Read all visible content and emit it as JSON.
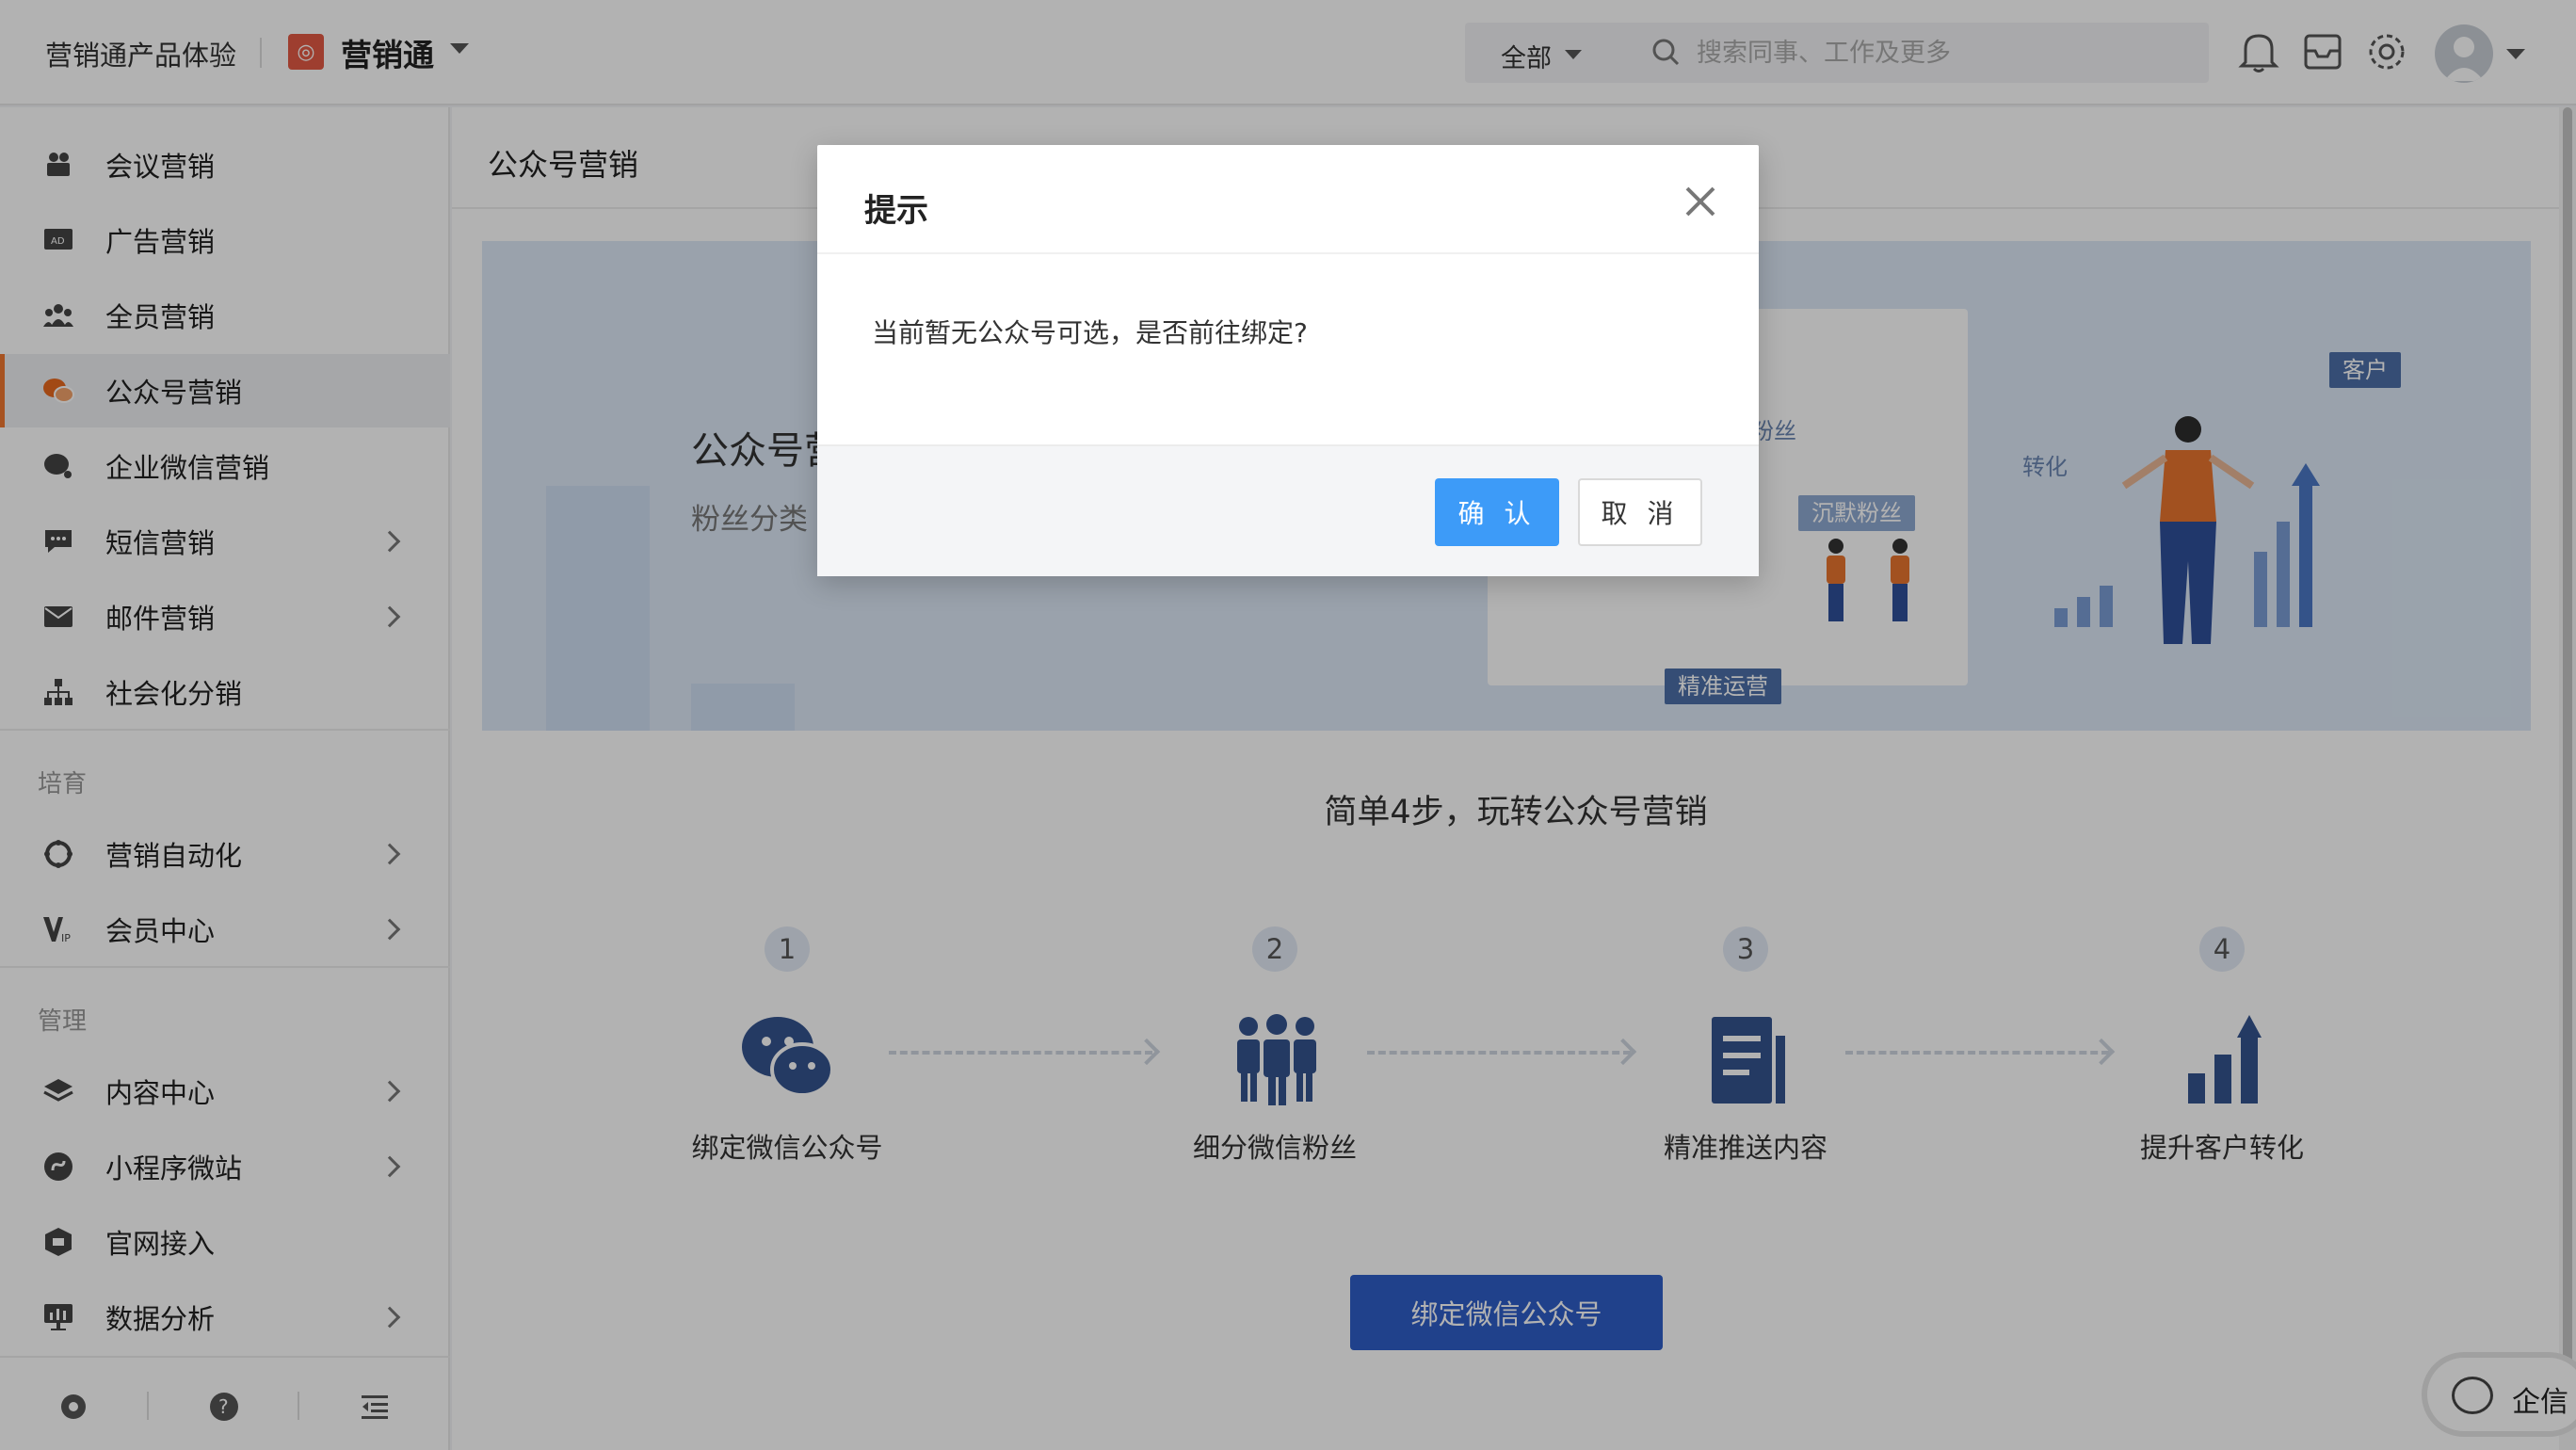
{
  "header": {
    "org_name": "营销通产品体验",
    "app_name": "营销通",
    "search_scope": "全部",
    "search_placeholder": "搜索同事、工作及更多"
  },
  "sidebar": {
    "items": [
      {
        "label": "会议营销",
        "icon": "meeting-icon",
        "chevron": false
      },
      {
        "label": "广告营销",
        "icon": "ad-icon",
        "chevron": false
      },
      {
        "label": "全员营销",
        "icon": "team-icon",
        "chevron": false
      },
      {
        "label": "公众号营销",
        "icon": "wechat-icon",
        "chevron": false,
        "active": true
      },
      {
        "label": "企业微信营销",
        "icon": "work-wechat-icon",
        "chevron": false
      },
      {
        "label": "短信营销",
        "icon": "sms-icon",
        "chevron": true
      },
      {
        "label": "邮件营销",
        "icon": "mail-icon",
        "chevron": true
      },
      {
        "label": "社会化分销",
        "icon": "org-tree-icon",
        "chevron": false
      }
    ],
    "section_nurture": "培育",
    "nurture_items": [
      {
        "label": "营销自动化",
        "icon": "automation-icon",
        "chevron": true
      },
      {
        "label": "会员中心",
        "icon": "vip-icon",
        "chevron": true
      }
    ],
    "section_manage": "管理",
    "manage_items": [
      {
        "label": "内容中心",
        "icon": "layers-icon",
        "chevron": true
      },
      {
        "label": "小程序微站",
        "icon": "mini-program-icon",
        "chevron": true
      },
      {
        "label": "官网接入",
        "icon": "website-icon",
        "chevron": false
      },
      {
        "label": "数据分析",
        "icon": "analytics-icon",
        "chevron": true
      }
    ]
  },
  "main": {
    "page_title": "公众号营销",
    "banner": {
      "title": "公众号营",
      "subtitle": "粉丝分类",
      "tag_fans": "粉丝",
      "tag_silent": "沉默粉丝",
      "tag_precise": "精准运营",
      "tag_convert": "转化",
      "tag_customer": "客户"
    },
    "steps_title": "简单4步，玩转公众号营销",
    "steps": [
      {
        "num": "1",
        "label": "绑定微信公众号"
      },
      {
        "num": "2",
        "label": "细分微信粉丝"
      },
      {
        "num": "3",
        "label": "精准推送内容"
      },
      {
        "num": "4",
        "label": "提升客户转化"
      }
    ],
    "bind_button": "绑定微信公众号"
  },
  "chat": {
    "label": "企信"
  },
  "modal": {
    "title": "提示",
    "message": "当前暂无公众号可选，是否前往绑定?",
    "confirm": "确 认",
    "cancel": "取 消"
  },
  "colors": {
    "accent": "#3d9bf8",
    "primary_button": "#2e5ec8",
    "active_marker": "#f07830",
    "icon_blue": "#34538f"
  }
}
